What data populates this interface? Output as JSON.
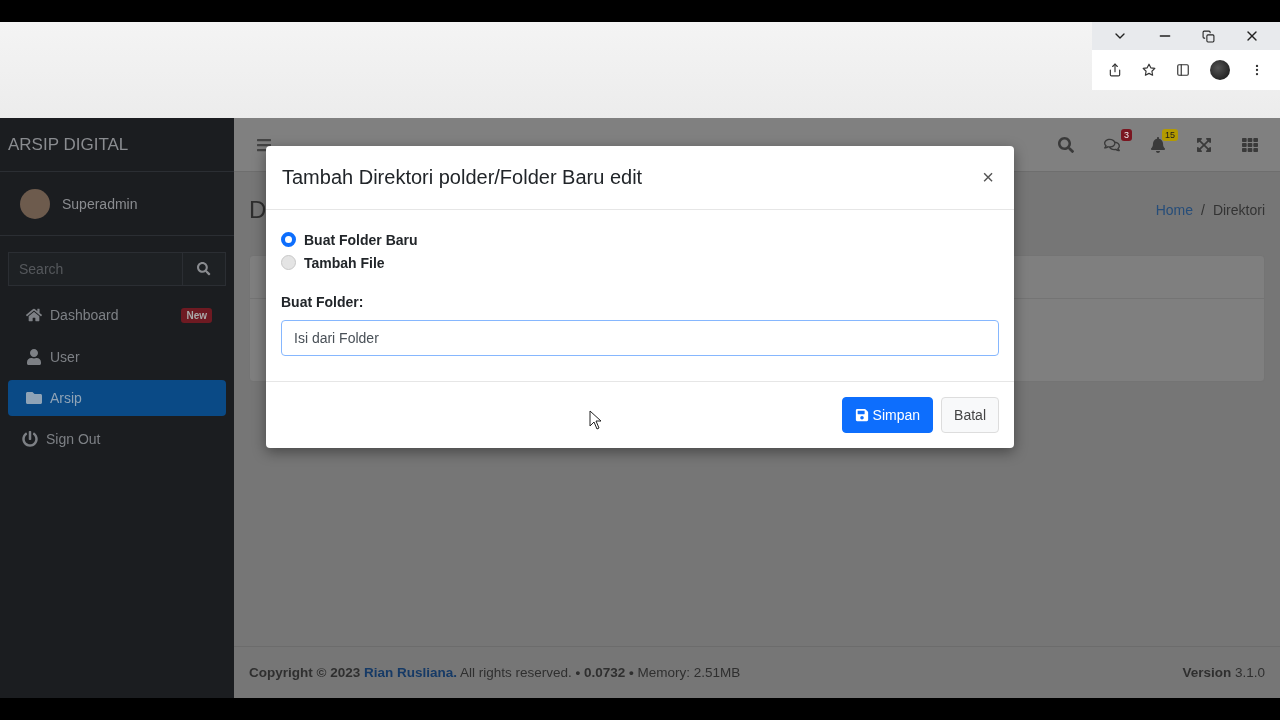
{
  "sidebar": {
    "brand": "ARSIP DIGITAL",
    "user": "Superadmin",
    "search": {
      "placeholder": "Search"
    },
    "items": [
      {
        "label": "Dashboard",
        "kind": "home",
        "badge": "New",
        "selected": false
      },
      {
        "label": "User",
        "kind": "user",
        "selected": false
      },
      {
        "label": "Arsip",
        "kind": "folder",
        "selected": true
      },
      {
        "label": "Sign Out",
        "kind": "power",
        "selected": false
      }
    ]
  },
  "navbar": {
    "message_count": "3",
    "notification_count": "15"
  },
  "page": {
    "title": "D",
    "breadcrumb": [
      {
        "label": "Home",
        "kind": "link"
      },
      {
        "label": "Direktori",
        "kind": "current",
        "separator": "/"
      }
    ]
  },
  "modal": {
    "title": "Tambah Direktori polder/Folder Baru edit",
    "close": "×",
    "options": [
      {
        "label": "Buat Folder Baru",
        "selected": true
      },
      {
        "label": "Tambah File",
        "selected": false
      }
    ],
    "field_label": "Buat Folder:",
    "field_value": "Isi dari Folder",
    "buttons": [
      {
        "label": "Simpan",
        "kind": "primary"
      },
      {
        "label": "Batal",
        "kind": "secondary"
      }
    ]
  },
  "footer": {
    "copyright_start": "**Copyright © 2023**",
    "author": "Rian Rusliana.",
    "copyright_end": "All rights reserved. **• 0.0732 •** Memory: 2.51MB",
    "version": "**Version** 3.1.0"
  }
}
